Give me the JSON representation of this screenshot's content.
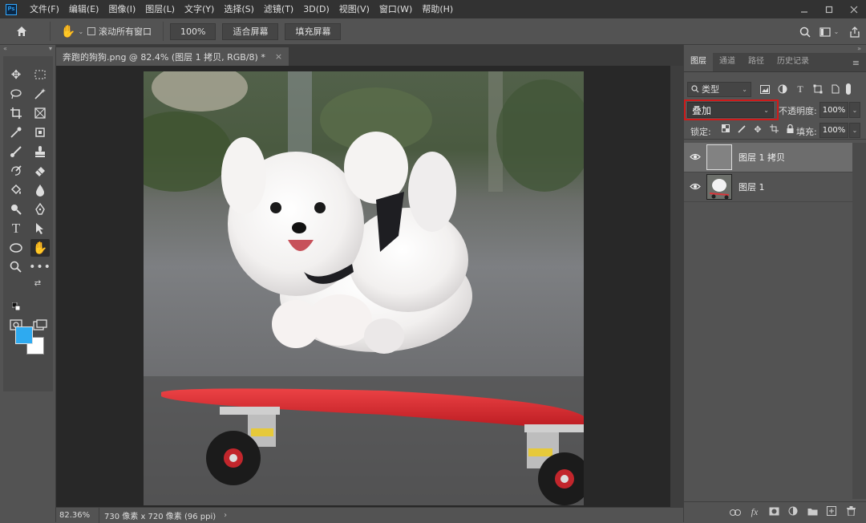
{
  "app": {
    "logo_text": "Ps"
  },
  "menu": [
    "文件(F)",
    "编辑(E)",
    "图像(I)",
    "图层(L)",
    "文字(Y)",
    "选择(S)",
    "滤镜(T)",
    "3D(D)",
    "视图(V)",
    "窗口(W)",
    "帮助(H)"
  ],
  "options": {
    "scroll_all_label": "滚动所有窗口",
    "zoom_button": "100%",
    "fit_screen_button": "适合屏幕",
    "fill_screen_button": "填充屏幕"
  },
  "document": {
    "tab_title": "奔跑的狗狗.png @ 82.4% (图层 1 拷贝, RGB/8) *",
    "close_glyph": "×"
  },
  "status": {
    "zoom": "82.36%",
    "info": "730 像素 x 720 像素 (96 ppi)",
    "arrow": "›"
  },
  "colors": {
    "foreground": "#2eaaf0",
    "background": "#ffffff",
    "highlight_outline": "#d01a1a"
  },
  "panel": {
    "tabs": [
      "图层",
      "通道",
      "路径",
      "历史记录"
    ],
    "filter_label": "类型",
    "blend_mode": "叠加",
    "opacity_label": "不透明度:",
    "opacity_value": "100%",
    "lock_label": "锁定:",
    "fill_label": "填充:",
    "fill_value": "100%",
    "layers": [
      {
        "name": "图层 1 拷贝",
        "selected": true
      },
      {
        "name": "图层 1",
        "selected": false
      }
    ]
  }
}
